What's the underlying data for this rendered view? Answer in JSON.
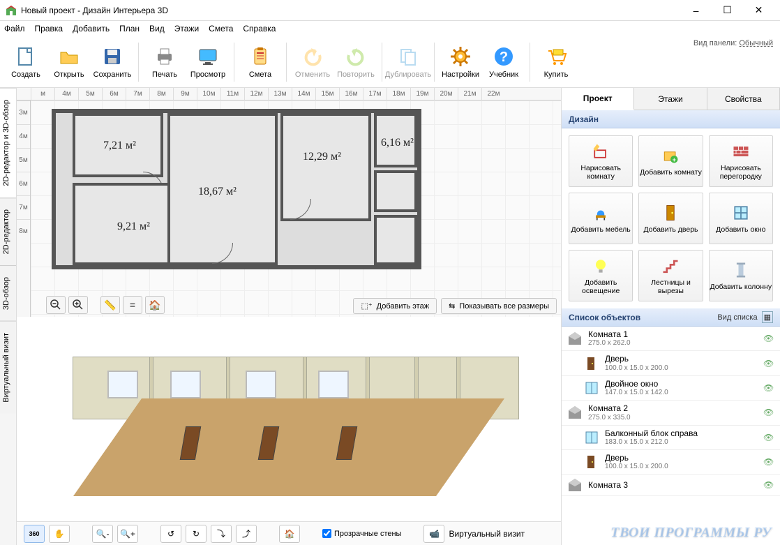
{
  "title": "Новый проект - Дизайн Интерьера 3D",
  "menu": [
    "Файл",
    "Правка",
    "Добавить",
    "План",
    "Вид",
    "Этажи",
    "Смета",
    "Справка"
  ],
  "toolbar": [
    {
      "id": "create",
      "label": "Создать",
      "icon": "file"
    },
    {
      "id": "open",
      "label": "Открыть",
      "icon": "folder"
    },
    {
      "id": "save",
      "label": "Сохранить",
      "icon": "disk"
    },
    {
      "sep": true
    },
    {
      "id": "print",
      "label": "Печать",
      "icon": "printer"
    },
    {
      "id": "preview",
      "label": "Просмотр",
      "icon": "monitor"
    },
    {
      "sep": true
    },
    {
      "id": "estimate",
      "label": "Смета",
      "icon": "clipboard"
    },
    {
      "sep": true
    },
    {
      "id": "undo",
      "label": "Отменить",
      "icon": "undo",
      "disabled": true
    },
    {
      "id": "redo",
      "label": "Повторить",
      "icon": "redo",
      "disabled": true
    },
    {
      "sep": true
    },
    {
      "id": "dup",
      "label": "Дублировать",
      "icon": "copy",
      "disabled": true
    },
    {
      "sep": true
    },
    {
      "id": "settings",
      "label": "Настройки",
      "icon": "gear"
    },
    {
      "id": "help",
      "label": "Учебник",
      "icon": "help"
    },
    {
      "sep": true
    },
    {
      "id": "buy",
      "label": "Купить",
      "icon": "cart"
    }
  ],
  "panel_mode": {
    "label": "Вид панели:",
    "value": "Обычный"
  },
  "side_tabs": [
    "2D-редактор и 3D-обзор",
    "2D-редактор",
    "3D-обзор",
    "Виртуальный визит"
  ],
  "ruler_h": [
    "м",
    "4м",
    "5м",
    "6м",
    "7м",
    "8м",
    "9м",
    "10м",
    "11м",
    "12м",
    "13м",
    "14м",
    "15м",
    "16м",
    "17м",
    "18м",
    "19м",
    "20м",
    "21м",
    "22м"
  ],
  "ruler_v": [
    "3м",
    "4м",
    "5м",
    "6м",
    "7м",
    "8м"
  ],
  "rooms": {
    "r1": "7,21 м²",
    "r2": "18,67 м²",
    "r3": "12,29 м²",
    "r4": "9,21 м²",
    "r5": "6,16 м²"
  },
  "plan_buttons": {
    "add_floor": "Добавить этаж",
    "show_dims": "Показывать все размеры"
  },
  "bottom": {
    "transparent": "Прозрачные стены",
    "vv": "Виртуальный визит"
  },
  "rp_tabs": [
    "Проект",
    "Этажи",
    "Свойства"
  ],
  "design_head": "Дизайн",
  "tools": [
    {
      "id": "draw-room",
      "label": "Нарисовать комнату",
      "icon": "pencil-room"
    },
    {
      "id": "add-room",
      "label": "Добавить комнату",
      "icon": "add-room"
    },
    {
      "id": "draw-wall",
      "label": "Нарисовать перегородку",
      "icon": "wall"
    },
    {
      "id": "add-furniture",
      "label": "Добавить мебель",
      "icon": "chair"
    },
    {
      "id": "add-door",
      "label": "Добавить дверь",
      "icon": "door"
    },
    {
      "id": "add-window",
      "label": "Добавить окно",
      "icon": "window"
    },
    {
      "id": "add-light",
      "label": "Добавить освещение",
      "icon": "bulb"
    },
    {
      "id": "stairs",
      "label": "Лестницы и вырезы",
      "icon": "stairs"
    },
    {
      "id": "add-column",
      "label": "Добавить колонну",
      "icon": "column"
    }
  ],
  "objects_head": "Список объектов",
  "list_view": "Вид списка",
  "objects": [
    {
      "name": "Комната 1",
      "dims": "275.0 x 262.0",
      "type": "room"
    },
    {
      "name": "Дверь",
      "dims": "100.0 x 15.0 x 200.0",
      "type": "door",
      "child": true
    },
    {
      "name": "Двойное окно",
      "dims": "147.0 x 15.0 x 142.0",
      "type": "window",
      "child": true
    },
    {
      "name": "Комната 2",
      "dims": "275.0 x 335.0",
      "type": "room"
    },
    {
      "name": "Балконный блок справа",
      "dims": "183.0 x 15.0 x 212.0",
      "type": "window",
      "child": true
    },
    {
      "name": "Дверь",
      "dims": "100.0 x 15.0 x 200.0",
      "type": "door",
      "child": true
    },
    {
      "name": "Комната 3",
      "dims": "",
      "type": "room"
    }
  ],
  "watermark": "ТВОИ ПРОГРАММЫ РУ"
}
